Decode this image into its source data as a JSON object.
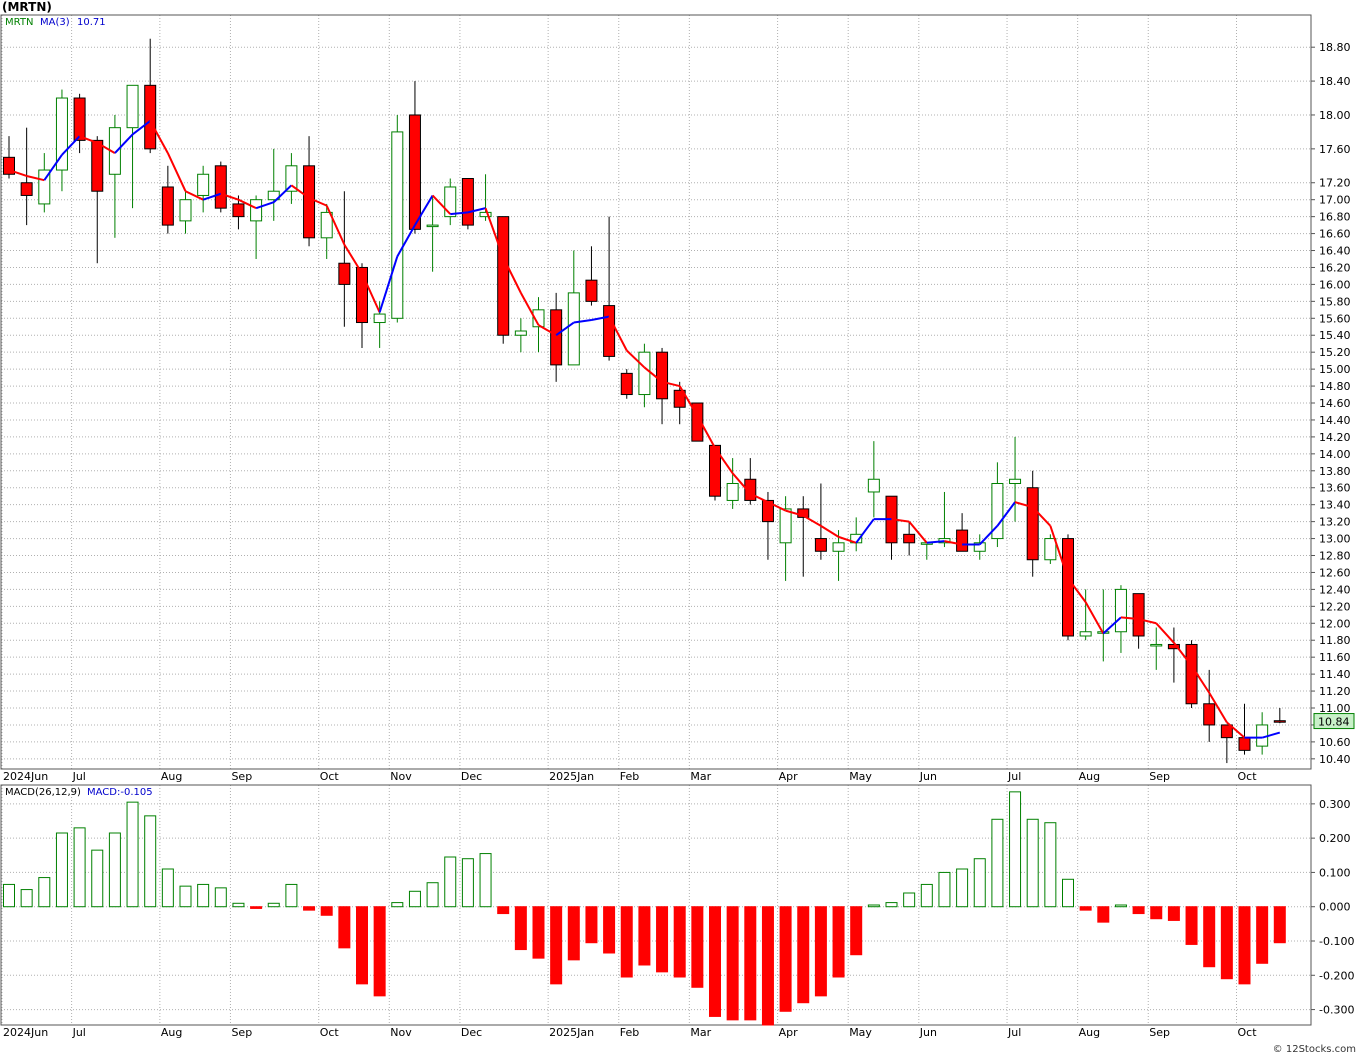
{
  "title": "(MRTN)",
  "footer": "© 12Stocks.com",
  "colors": {
    "up": "#008000",
    "down": "#ff0000",
    "ma_up": "#0000ff",
    "ma_down": "#ff0000",
    "grid": "#b0b0b0",
    "last_bg": "#c8f0c8"
  },
  "price_panel": {
    "legend_symbol": "MRTN",
    "legend_ma": "MA(3)",
    "legend_ma_value": "10.71",
    "last_price": "10.84",
    "ylim": [
      10.28,
      19.18
    ],
    "yticks": [
      "10.40",
      "10.60",
      "10.80",
      "11.00",
      "11.20",
      "11.40",
      "11.60",
      "11.80",
      "12.00",
      "12.20",
      "12.40",
      "12.60",
      "12.80",
      "13.00",
      "13.20",
      "13.40",
      "13.60",
      "13.80",
      "14.00",
      "14.20",
      "14.40",
      "14.60",
      "14.80",
      "15.00",
      "15.20",
      "15.40",
      "15.60",
      "15.80",
      "16.00",
      "16.20",
      "16.40",
      "16.60",
      "16.80",
      "17.00",
      "17.20",
      "17.60",
      "18.00",
      "18.40",
      "18.80"
    ]
  },
  "macd_panel": {
    "legend_label": "MACD(26,12,9)",
    "legend_value": "MACD:-0.105",
    "ylim": [
      -0.345,
      0.355
    ],
    "yticks": [
      "0.300",
      "0.200",
      "0.100",
      "0.000",
      "-0.100",
      "-0.200",
      "-0.300"
    ]
  },
  "x_axis_labels": [
    {
      "label": "2024Jun",
      "i": 0
    },
    {
      "label": "Jul",
      "i": 4
    },
    {
      "label": "Aug",
      "i": 9
    },
    {
      "label": "Sep",
      "i": 13
    },
    {
      "label": "Oct",
      "i": 18
    },
    {
      "label": "Nov",
      "i": 22
    },
    {
      "label": "Dec",
      "i": 26
    },
    {
      "label": "2025Jan",
      "i": 31
    },
    {
      "label": "Feb",
      "i": 35
    },
    {
      "label": "Mar",
      "i": 39
    },
    {
      "label": "Apr",
      "i": 44
    },
    {
      "label": "May",
      "i": 48
    },
    {
      "label": "Jun",
      "i": 52
    },
    {
      "label": "Jul",
      "i": 57
    },
    {
      "label": "Aug",
      "i": 61
    },
    {
      "label": "Sep",
      "i": 65
    },
    {
      "label": "Oct",
      "i": 70
    }
  ],
  "chart_data": {
    "type": "candlestick",
    "period": "weekly",
    "candles": [
      {
        "o": 17.5,
        "h": 17.75,
        "l": 17.25,
        "c": 17.3
      },
      {
        "o": 17.2,
        "h": 17.85,
        "l": 16.7,
        "c": 17.05
      },
      {
        "o": 16.95,
        "h": 17.55,
        "l": 16.85,
        "c": 17.35
      },
      {
        "o": 17.35,
        "h": 18.3,
        "l": 17.1,
        "c": 18.2
      },
      {
        "o": 18.2,
        "h": 18.25,
        "l": 17.55,
        "c": 17.7
      },
      {
        "o": 17.7,
        "h": 17.75,
        "l": 16.25,
        "c": 17.1
      },
      {
        "o": 17.3,
        "h": 18.0,
        "l": 16.55,
        "c": 17.85
      },
      {
        "o": 17.85,
        "h": 18.35,
        "l": 16.9,
        "c": 18.35
      },
      {
        "o": 18.35,
        "h": 18.9,
        "l": 17.55,
        "c": 17.6
      },
      {
        "o": 17.15,
        "h": 17.4,
        "l": 16.6,
        "c": 16.7
      },
      {
        "o": 16.75,
        "h": 17.1,
        "l": 16.6,
        "c": 17.0
      },
      {
        "o": 17.05,
        "h": 17.4,
        "l": 16.85,
        "c": 17.3
      },
      {
        "o": 17.4,
        "h": 17.45,
        "l": 16.85,
        "c": 16.9
      },
      {
        "o": 16.95,
        "h": 17.05,
        "l": 16.65,
        "c": 16.8
      },
      {
        "o": 16.75,
        "h": 17.05,
        "l": 16.3,
        "c": 17.0
      },
      {
        "o": 17.0,
        "h": 17.6,
        "l": 16.75,
        "c": 17.1
      },
      {
        "o": 17.1,
        "h": 17.55,
        "l": 16.95,
        "c": 17.4
      },
      {
        "o": 17.4,
        "h": 17.75,
        "l": 16.45,
        "c": 16.55
      },
      {
        "o": 16.55,
        "h": 16.95,
        "l": 16.3,
        "c": 16.85
      },
      {
        "o": 16.25,
        "h": 17.1,
        "l": 15.5,
        "c": 16.0
      },
      {
        "o": 16.2,
        "h": 16.25,
        "l": 15.25,
        "c": 15.55
      },
      {
        "o": 15.55,
        "h": 15.8,
        "l": 15.25,
        "c": 15.65
      },
      {
        "o": 15.6,
        "h": 18.0,
        "l": 15.55,
        "c": 17.8
      },
      {
        "o": 18.0,
        "h": 18.4,
        "l": 16.6,
        "c": 16.65
      },
      {
        "o": 16.7,
        "h": 17.05,
        "l": 16.15,
        "c": 16.7
      },
      {
        "o": 16.8,
        "h": 17.25,
        "l": 16.7,
        "c": 17.15
      },
      {
        "o": 17.25,
        "h": 17.25,
        "l": 16.65,
        "c": 16.7
      },
      {
        "o": 16.8,
        "h": 17.3,
        "l": 16.75,
        "c": 16.85
      },
      {
        "o": 16.8,
        "h": 16.8,
        "l": 15.3,
        "c": 15.4
      },
      {
        "o": 15.4,
        "h": 15.6,
        "l": 15.2,
        "c": 15.45
      },
      {
        "o": 15.5,
        "h": 15.85,
        "l": 15.2,
        "c": 15.7
      },
      {
        "o": 15.7,
        "h": 15.9,
        "l": 14.85,
        "c": 15.05
      },
      {
        "o": 15.05,
        "h": 16.4,
        "l": 15.05,
        "c": 15.9
      },
      {
        "o": 16.05,
        "h": 16.45,
        "l": 15.75,
        "c": 15.8
      },
      {
        "o": 15.75,
        "h": 16.8,
        "l": 15.1,
        "c": 15.15
      },
      {
        "o": 14.95,
        "h": 15.0,
        "l": 14.65,
        "c": 14.7
      },
      {
        "o": 14.7,
        "h": 15.3,
        "l": 14.55,
        "c": 15.2
      },
      {
        "o": 15.2,
        "h": 15.25,
        "l": 14.35,
        "c": 14.65
      },
      {
        "o": 14.75,
        "h": 14.85,
        "l": 14.35,
        "c": 14.55
      },
      {
        "o": 14.6,
        "h": 14.6,
        "l": 14.15,
        "c": 14.15
      },
      {
        "o": 14.1,
        "h": 14.1,
        "l": 13.45,
        "c": 13.5
      },
      {
        "o": 13.45,
        "h": 13.95,
        "l": 13.35,
        "c": 13.65
      },
      {
        "o": 13.7,
        "h": 13.95,
        "l": 13.4,
        "c": 13.45
      },
      {
        "o": 13.45,
        "h": 13.55,
        "l": 12.75,
        "c": 13.2
      },
      {
        "o": 12.95,
        "h": 13.5,
        "l": 12.5,
        "c": 13.35
      },
      {
        "o": 13.35,
        "h": 13.5,
        "l": 12.55,
        "c": 13.25
      },
      {
        "o": 13.0,
        "h": 13.65,
        "l": 12.75,
        "c": 12.85
      },
      {
        "o": 12.85,
        "h": 13.1,
        "l": 12.5,
        "c": 12.95
      },
      {
        "o": 12.95,
        "h": 13.25,
        "l": 12.85,
        "c": 13.05
      },
      {
        "o": 13.55,
        "h": 14.15,
        "l": 13.25,
        "c": 13.7
      },
      {
        "o": 13.5,
        "h": 13.5,
        "l": 12.75,
        "c": 12.95
      },
      {
        "o": 13.05,
        "h": 13.2,
        "l": 12.8,
        "c": 12.95
      },
      {
        "o": 12.95,
        "h": 12.95,
        "l": 12.75,
        "c": 12.95
      },
      {
        "o": 12.95,
        "h": 13.55,
        "l": 12.9,
        "c": 13.0
      },
      {
        "o": 13.1,
        "h": 13.3,
        "l": 12.85,
        "c": 12.85
      },
      {
        "o": 12.85,
        "h": 13.05,
        "l": 12.75,
        "c": 12.95
      },
      {
        "o": 13.0,
        "h": 13.9,
        "l": 12.9,
        "c": 13.65
      },
      {
        "o": 13.65,
        "h": 14.2,
        "l": 13.2,
        "c": 13.7
      },
      {
        "o": 13.6,
        "h": 13.8,
        "l": 12.55,
        "c": 12.75
      },
      {
        "o": 12.75,
        "h": 13.05,
        "l": 12.7,
        "c": 13.0
      },
      {
        "o": 13.0,
        "h": 13.05,
        "l": 11.8,
        "c": 11.85
      },
      {
        "o": 11.85,
        "h": 12.4,
        "l": 11.8,
        "c": 11.9
      },
      {
        "o": 11.9,
        "h": 12.4,
        "l": 11.55,
        "c": 11.9
      },
      {
        "o": 11.9,
        "h": 12.45,
        "l": 11.65,
        "c": 12.4
      },
      {
        "o": 12.35,
        "h": 12.35,
        "l": 11.7,
        "c": 11.85
      },
      {
        "o": 11.75,
        "h": 11.95,
        "l": 11.45,
        "c": 11.75
      },
      {
        "o": 11.75,
        "h": 11.95,
        "l": 11.3,
        "c": 11.7
      },
      {
        "o": 11.75,
        "h": 11.8,
        "l": 11.0,
        "c": 11.05
      },
      {
        "o": 11.05,
        "h": 11.45,
        "l": 10.6,
        "c": 10.8
      },
      {
        "o": 10.8,
        "h": 10.8,
        "l": 10.35,
        "c": 10.65
      },
      {
        "o": 10.65,
        "h": 11.05,
        "l": 10.45,
        "c": 10.5
      },
      {
        "o": 10.55,
        "h": 10.95,
        "l": 10.45,
        "c": 10.8
      },
      {
        "o": 10.85,
        "h": 11.0,
        "l": 10.82,
        "c": 10.84
      }
    ],
    "ma3": [
      17.35,
      17.28,
      17.23,
      17.53,
      17.75,
      17.67,
      17.55,
      17.77,
      17.93,
      17.55,
      17.1,
      17.0,
      17.07,
      17.0,
      16.9,
      16.97,
      17.17,
      17.02,
      16.93,
      16.47,
      16.13,
      15.67,
      16.33,
      16.7,
      17.05,
      16.83,
      16.85,
      16.9,
      16.32,
      15.9,
      15.52,
      15.4,
      15.55,
      15.58,
      15.62,
      15.22,
      15.02,
      14.85,
      14.8,
      14.45,
      14.07,
      13.77,
      13.53,
      13.43,
      13.33,
      13.27,
      13.15,
      13.02,
      12.95,
      13.23,
      13.23,
      13.2,
      12.95,
      12.97,
      12.93,
      12.93,
      13.15,
      13.43,
      13.37,
      13.15,
      12.53,
      12.25,
      11.88,
      12.07,
      12.05,
      12.0,
      11.77,
      11.5,
      11.18,
      10.83,
      10.65,
      10.65,
      10.71
    ],
    "macd": [
      0.065,
      0.05,
      0.085,
      0.215,
      0.23,
      0.165,
      0.215,
      0.305,
      0.265,
      0.11,
      0.06,
      0.065,
      0.055,
      0.01,
      -0.005,
      0.01,
      0.065,
      -0.01,
      -0.025,
      -0.12,
      -0.225,
      -0.26,
      0.012,
      0.045,
      0.07,
      0.145,
      0.14,
      0.155,
      -0.02,
      -0.125,
      -0.15,
      -0.225,
      -0.155,
      -0.105,
      -0.135,
      -0.205,
      -0.17,
      -0.19,
      -0.205,
      -0.235,
      -0.32,
      -0.33,
      -0.33,
      -0.345,
      -0.305,
      -0.28,
      -0.26,
      -0.205,
      -0.14,
      0.005,
      0.012,
      0.04,
      0.065,
      0.1,
      0.11,
      0.14,
      0.255,
      0.335,
      0.255,
      0.245,
      0.08,
      -0.01,
      -0.045,
      0.005,
      -0.02,
      -0.035,
      -0.04,
      -0.11,
      -0.175,
      -0.21,
      -0.225,
      -0.165,
      -0.105
    ]
  }
}
